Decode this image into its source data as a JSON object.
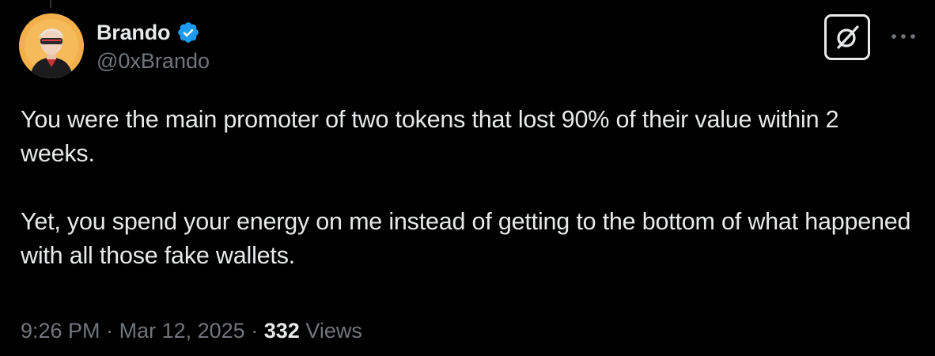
{
  "tweet": {
    "author": {
      "display_name": "Brando",
      "handle": "@0xBrando",
      "verified": true,
      "verified_color": "#1d9bf0"
    },
    "paragraphs": [
      "You were the main promoter of two tokens that lost 90% of their value within 2 weeks.",
      "Yet, you spend your energy on me instead of getting to the bottom of what happened with all those fake wallets."
    ],
    "time": "9:26 PM",
    "separator": "·",
    "date": "Mar 12, 2025",
    "views_count": "332",
    "views_label": "Views"
  },
  "icons": {
    "grok": "grok-icon",
    "more": "more-horizontal-icon",
    "verified": "verified-badge-icon"
  },
  "colors": {
    "background": "#000000",
    "text_primary": "#e7e9ea",
    "text_secondary": "#71767b"
  }
}
